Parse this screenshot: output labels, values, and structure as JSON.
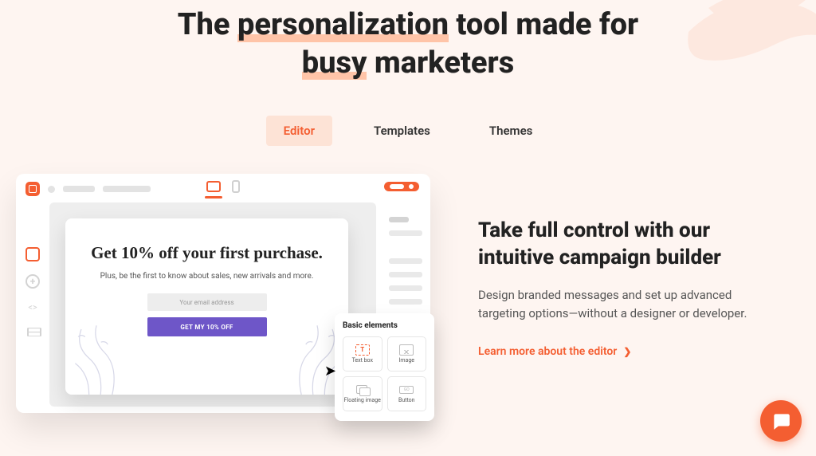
{
  "hero": {
    "line1_pre": "The ",
    "line1_hl": "personalization",
    "line1_post": " tool made for",
    "line2_hl": "busy",
    "line2_post": " marketers"
  },
  "tabs": {
    "editor": "Editor",
    "templates": "Templates",
    "themes": "Themes"
  },
  "preview": {
    "popup_heading": "Get 10% off your first purchase.",
    "popup_sub": "Plus, be the first to know about sales, new arrivals and more.",
    "popup_placeholder": "Your email address",
    "popup_cta": "GET MY 10% OFF",
    "elements_title": "Basic elements",
    "elements": {
      "text_box": "Text box",
      "image": "Image",
      "floating_image": "Floating image",
      "button": "Button"
    }
  },
  "info": {
    "heading": "Take full control with our intuitive campaign builder",
    "body": "Design branded messages and set up advanced targeting options—without a designer or developer.",
    "link": "Learn more about the editor"
  }
}
